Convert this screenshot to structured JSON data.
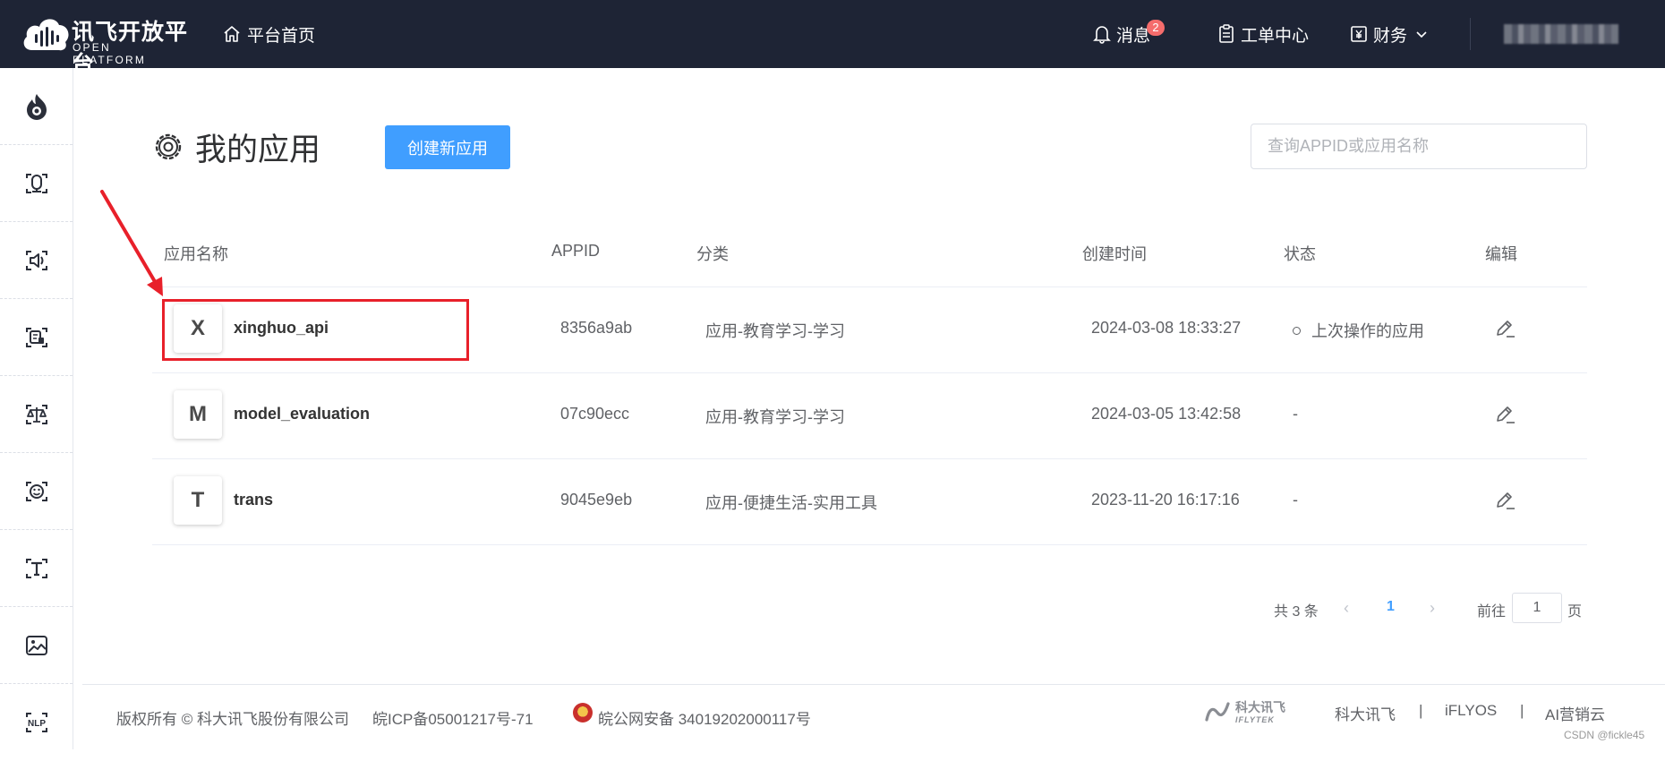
{
  "header": {
    "logo_cn": "讯飞开放平台",
    "logo_en": "OPEN PLATFORM",
    "home": "平台首页",
    "messages": "消息",
    "message_count": "2",
    "tickets": "工单中心",
    "finance": "财务"
  },
  "sidebar": {
    "items": [
      {
        "icon": "flame-icon"
      },
      {
        "icon": "voice-record-icon"
      },
      {
        "icon": "speaker-icon"
      },
      {
        "icon": "doc-chat-icon"
      },
      {
        "icon": "balance-scale-icon"
      },
      {
        "icon": "face-scan-icon"
      },
      {
        "icon": "text-scan-icon"
      },
      {
        "icon": "image-icon"
      },
      {
        "icon": "nlp-icon",
        "label": "NLP"
      }
    ]
  },
  "main": {
    "title": "我的应用",
    "create_button": "创建新应用",
    "search_placeholder": "查询APPID或应用名称",
    "columns": [
      "应用名称",
      "APPID",
      "分类",
      "创建时间",
      "状态",
      "编辑"
    ],
    "rows": [
      {
        "initial": "X",
        "name": "xinghuo_api",
        "appid": "8356a9ab",
        "category": "应用-教育学习-学习",
        "created": "2024-03-08 18:33:27",
        "status": "上次操作的应用"
      },
      {
        "initial": "M",
        "name": "model_evaluation",
        "appid": "07c90ecc",
        "category": "应用-教育学习-学习",
        "created": "2024-03-05 13:42:58",
        "status": "-"
      },
      {
        "initial": "T",
        "name": "trans",
        "appid": "9045e9eb",
        "category": "应用-便捷生活-实用工具",
        "created": "2023-11-20 16:17:16",
        "status": "-"
      }
    ]
  },
  "pagination": {
    "total": "共 3 条",
    "prev": "‹",
    "current": "1",
    "next": "›",
    "goto_label": "前往",
    "goto_value": "1",
    "page_label": "页"
  },
  "footer": {
    "copyright": "版权所有 © 科大讯飞股份有限公司",
    "icp": "皖ICP备05001217号-71",
    "police": "皖公网安备 34019202000117号",
    "links": [
      "科大讯飞",
      "iFLYOS",
      "AI营销云"
    ],
    "separator": "|",
    "brand_cn": "科大讯飞",
    "brand_en": "IFLYTEK",
    "watermark": "CSDN @fickle45"
  },
  "colors": {
    "topbar": "#1e2435",
    "primary": "#409eff",
    "highlight": "#e8202a",
    "badge": "#f56c6c"
  }
}
